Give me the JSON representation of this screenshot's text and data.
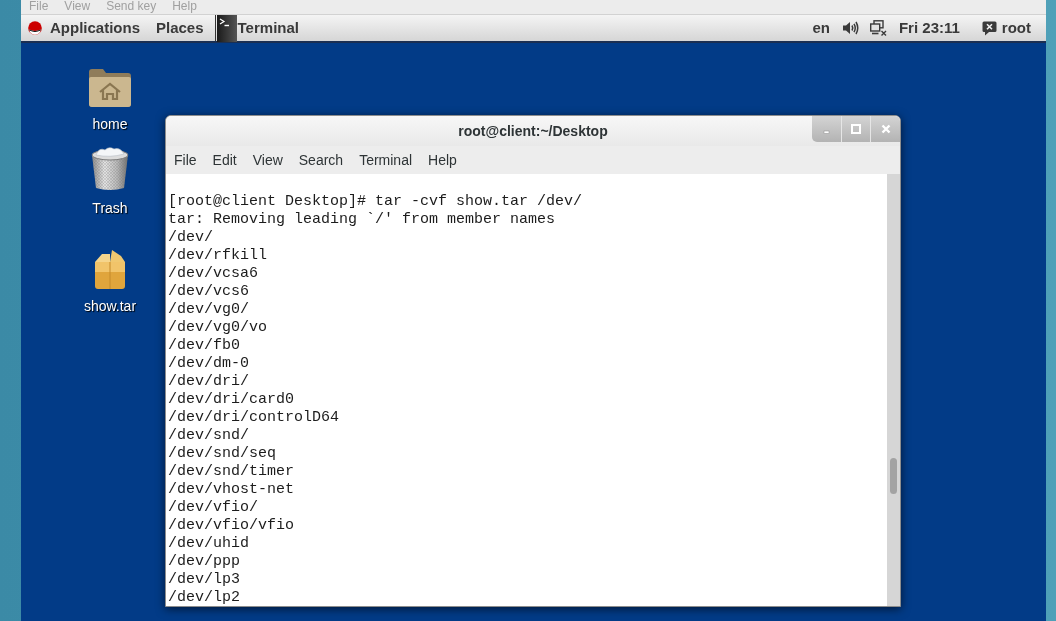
{
  "host_menu": [
    {
      "label": "File"
    },
    {
      "label": "View"
    },
    {
      "label": "Send key"
    },
    {
      "label": "Help"
    }
  ],
  "top_bar": {
    "menus": [
      "Applications",
      "Places"
    ],
    "window_list": [
      "Terminal"
    ],
    "status": {
      "language": "en",
      "clock": "Fri 23:11",
      "user": "root"
    }
  },
  "desktop_icons": [
    {
      "label": "home",
      "kind": "home"
    },
    {
      "label": "Trash",
      "kind": "trash"
    },
    {
      "label": "show.tar",
      "kind": "archive"
    }
  ],
  "terminal": {
    "title": "root@client:~/Desktop",
    "menu": [
      "File",
      "Edit",
      "View",
      "Search",
      "Terminal",
      "Help"
    ],
    "lines": [
      "[root@client Desktop]# tar -cvf show.tar /dev/",
      "tar: Removing leading `/' from member names",
      "/dev/",
      "/dev/rfkill",
      "/dev/vcsa6",
      "/dev/vcs6",
      "/dev/vg0/",
      "/dev/vg0/vo",
      "/dev/fb0",
      "/dev/dm-0",
      "/dev/dri/",
      "/dev/dri/card0",
      "/dev/dri/controlD64",
      "/dev/snd/",
      "/dev/snd/seq",
      "/dev/snd/timer",
      "/dev/vhost-net",
      "/dev/vfio/",
      "/dev/vfio/vfio",
      "/dev/uhid",
      "/dev/ppp",
      "/dev/lp3",
      "/dev/lp2"
    ]
  }
}
